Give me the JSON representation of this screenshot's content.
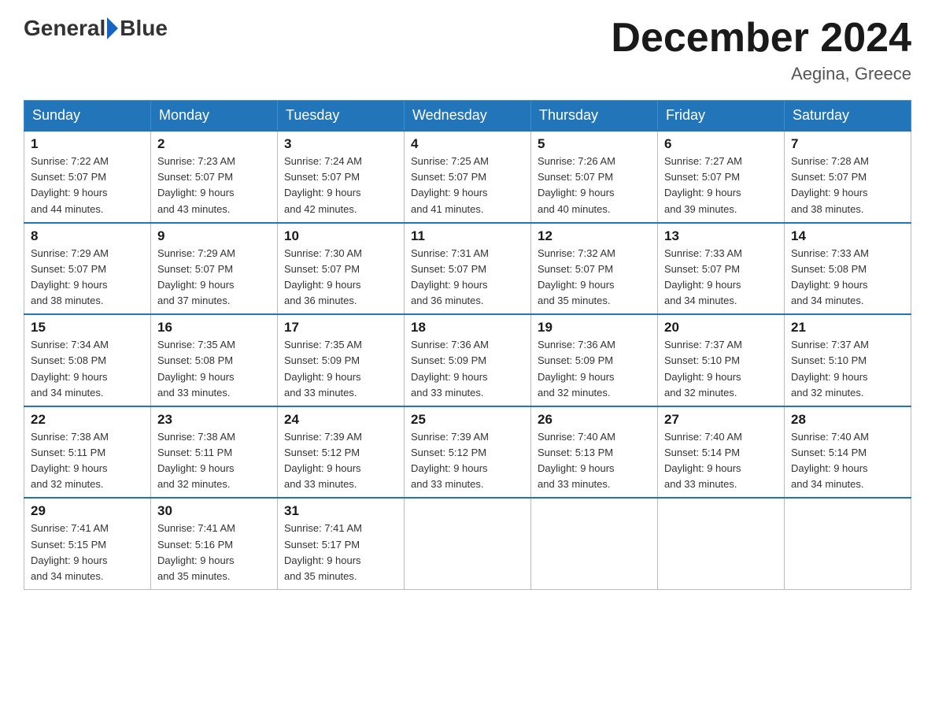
{
  "header": {
    "logo_general": "General",
    "logo_blue": "Blue",
    "month_title": "December 2024",
    "location": "Aegina, Greece"
  },
  "weekdays": [
    "Sunday",
    "Monday",
    "Tuesday",
    "Wednesday",
    "Thursday",
    "Friday",
    "Saturday"
  ],
  "weeks": [
    [
      {
        "day": "1",
        "sunrise": "7:22 AM",
        "sunset": "5:07 PM",
        "daylight": "9 hours and 44 minutes."
      },
      {
        "day": "2",
        "sunrise": "7:23 AM",
        "sunset": "5:07 PM",
        "daylight": "9 hours and 43 minutes."
      },
      {
        "day": "3",
        "sunrise": "7:24 AM",
        "sunset": "5:07 PM",
        "daylight": "9 hours and 42 minutes."
      },
      {
        "day": "4",
        "sunrise": "7:25 AM",
        "sunset": "5:07 PM",
        "daylight": "9 hours and 41 minutes."
      },
      {
        "day": "5",
        "sunrise": "7:26 AM",
        "sunset": "5:07 PM",
        "daylight": "9 hours and 40 minutes."
      },
      {
        "day": "6",
        "sunrise": "7:27 AM",
        "sunset": "5:07 PM",
        "daylight": "9 hours and 39 minutes."
      },
      {
        "day": "7",
        "sunrise": "7:28 AM",
        "sunset": "5:07 PM",
        "daylight": "9 hours and 38 minutes."
      }
    ],
    [
      {
        "day": "8",
        "sunrise": "7:29 AM",
        "sunset": "5:07 PM",
        "daylight": "9 hours and 38 minutes."
      },
      {
        "day": "9",
        "sunrise": "7:29 AM",
        "sunset": "5:07 PM",
        "daylight": "9 hours and 37 minutes."
      },
      {
        "day": "10",
        "sunrise": "7:30 AM",
        "sunset": "5:07 PM",
        "daylight": "9 hours and 36 minutes."
      },
      {
        "day": "11",
        "sunrise": "7:31 AM",
        "sunset": "5:07 PM",
        "daylight": "9 hours and 36 minutes."
      },
      {
        "day": "12",
        "sunrise": "7:32 AM",
        "sunset": "5:07 PM",
        "daylight": "9 hours and 35 minutes."
      },
      {
        "day": "13",
        "sunrise": "7:33 AM",
        "sunset": "5:07 PM",
        "daylight": "9 hours and 34 minutes."
      },
      {
        "day": "14",
        "sunrise": "7:33 AM",
        "sunset": "5:08 PM",
        "daylight": "9 hours and 34 minutes."
      }
    ],
    [
      {
        "day": "15",
        "sunrise": "7:34 AM",
        "sunset": "5:08 PM",
        "daylight": "9 hours and 34 minutes."
      },
      {
        "day": "16",
        "sunrise": "7:35 AM",
        "sunset": "5:08 PM",
        "daylight": "9 hours and 33 minutes."
      },
      {
        "day": "17",
        "sunrise": "7:35 AM",
        "sunset": "5:09 PM",
        "daylight": "9 hours and 33 minutes."
      },
      {
        "day": "18",
        "sunrise": "7:36 AM",
        "sunset": "5:09 PM",
        "daylight": "9 hours and 33 minutes."
      },
      {
        "day": "19",
        "sunrise": "7:36 AM",
        "sunset": "5:09 PM",
        "daylight": "9 hours and 32 minutes."
      },
      {
        "day": "20",
        "sunrise": "7:37 AM",
        "sunset": "5:10 PM",
        "daylight": "9 hours and 32 minutes."
      },
      {
        "day": "21",
        "sunrise": "7:37 AM",
        "sunset": "5:10 PM",
        "daylight": "9 hours and 32 minutes."
      }
    ],
    [
      {
        "day": "22",
        "sunrise": "7:38 AM",
        "sunset": "5:11 PM",
        "daylight": "9 hours and 32 minutes."
      },
      {
        "day": "23",
        "sunrise": "7:38 AM",
        "sunset": "5:11 PM",
        "daylight": "9 hours and 32 minutes."
      },
      {
        "day": "24",
        "sunrise": "7:39 AM",
        "sunset": "5:12 PM",
        "daylight": "9 hours and 33 minutes."
      },
      {
        "day": "25",
        "sunrise": "7:39 AM",
        "sunset": "5:12 PM",
        "daylight": "9 hours and 33 minutes."
      },
      {
        "day": "26",
        "sunrise": "7:40 AM",
        "sunset": "5:13 PM",
        "daylight": "9 hours and 33 minutes."
      },
      {
        "day": "27",
        "sunrise": "7:40 AM",
        "sunset": "5:14 PM",
        "daylight": "9 hours and 33 minutes."
      },
      {
        "day": "28",
        "sunrise": "7:40 AM",
        "sunset": "5:14 PM",
        "daylight": "9 hours and 34 minutes."
      }
    ],
    [
      {
        "day": "29",
        "sunrise": "7:41 AM",
        "sunset": "5:15 PM",
        "daylight": "9 hours and 34 minutes."
      },
      {
        "day": "30",
        "sunrise": "7:41 AM",
        "sunset": "5:16 PM",
        "daylight": "9 hours and 35 minutes."
      },
      {
        "day": "31",
        "sunrise": "7:41 AM",
        "sunset": "5:17 PM",
        "daylight": "9 hours and 35 minutes."
      },
      null,
      null,
      null,
      null
    ]
  ],
  "labels": {
    "sunrise_prefix": "Sunrise: ",
    "sunset_prefix": "Sunset: ",
    "daylight_prefix": "Daylight: "
  }
}
